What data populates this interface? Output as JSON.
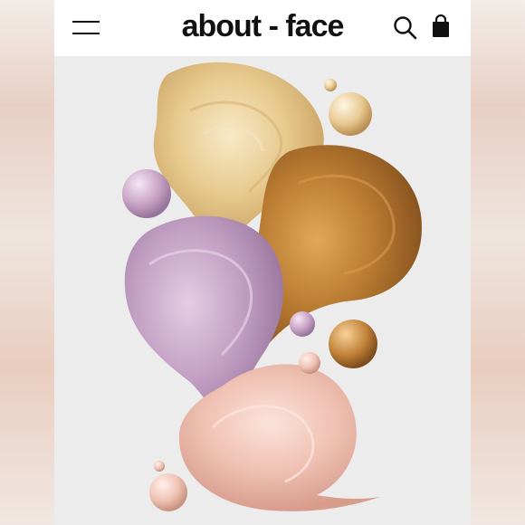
{
  "header": {
    "brand": "about - face",
    "menu_icon": "hamburger-menu-icon",
    "search_icon": "search-icon",
    "bag_icon": "shopping-bag-icon"
  },
  "hero": {
    "colors": {
      "gold": "#e3c27f",
      "bronze": "#b87a2e",
      "lilac": "#b78fb6",
      "rose": "#e9b7a7",
      "background": "#ececec"
    }
  }
}
